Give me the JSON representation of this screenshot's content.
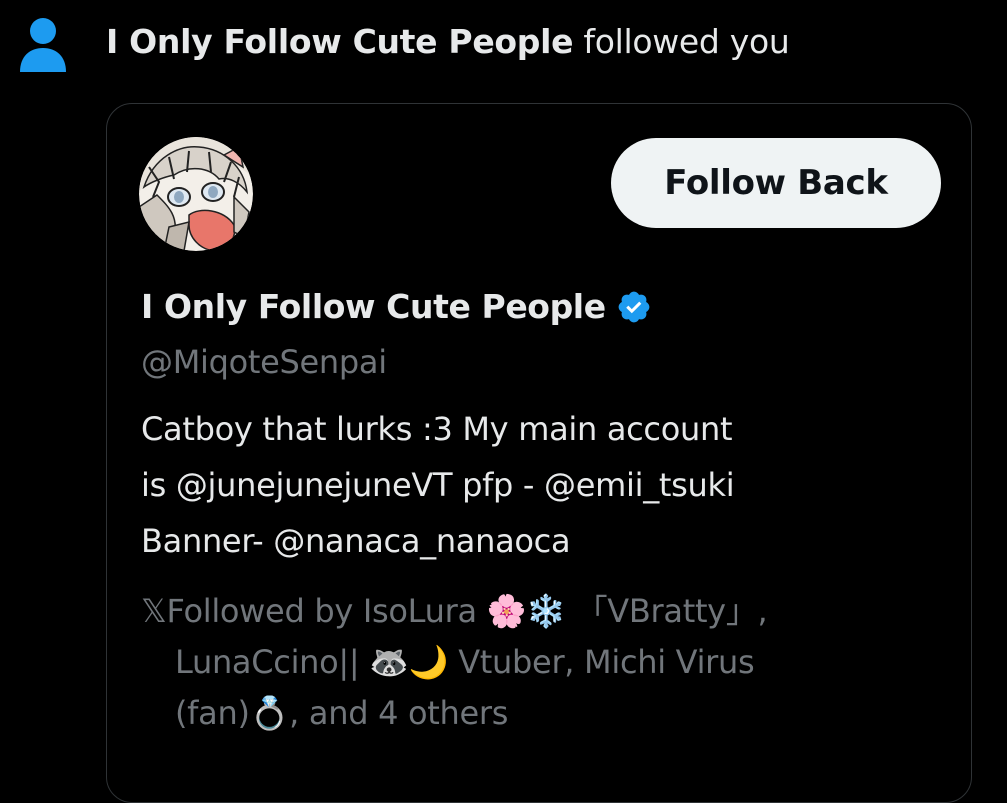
{
  "notification": {
    "icon": "person-icon",
    "icon_color": "#1d9bf0",
    "name": "I Only Follow Cute People",
    "action": "followed you"
  },
  "profile": {
    "display_name": "I Only Follow Cute People",
    "verified": true,
    "verified_color": "#1d9bf0",
    "handle": "@MiqoteSenpai",
    "follow_button_label": "Follow Back",
    "bio_lines": [
      "Catboy that lurks :3  My main account",
      "is @junejunejuneVT  pfp - @emii_tsuki",
      "Banner- @nanaca_nanaoca"
    ],
    "followed_by_lines": [
      "𝕏Followed by IsoLura 🌸❄️ 「VBratty」,",
      "LunaCcino|| 🦝🌙 Vtuber, Michi Virus",
      "(fan)💍, and 4 others"
    ]
  }
}
